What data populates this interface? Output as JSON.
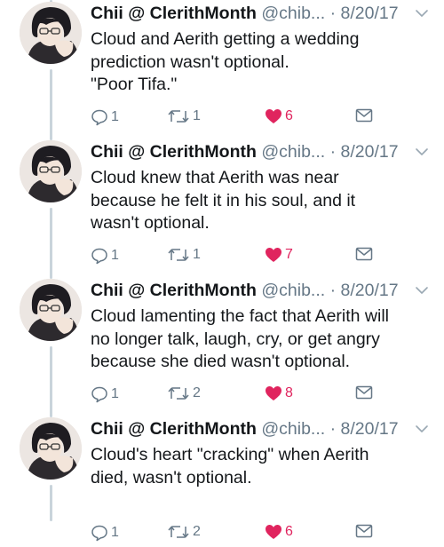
{
  "tweets": [
    {
      "name": "Chii @ ClerithMonth",
      "handle": "@chib...",
      "date": "· 8/20/17",
      "lines": [
        "Cloud and Aerith getting a wedding",
        "prediction wasn't optional.",
        "\"Poor Tifa.\""
      ],
      "replies": "1",
      "retweets": "1",
      "likes": "6"
    },
    {
      "name": "Chii @ ClerithMonth",
      "handle": "@chib...",
      "date": "· 8/20/17",
      "lines": [
        "Cloud knew that Aerith was near",
        "because he felt it in his soul, and it",
        "wasn't optional."
      ],
      "replies": "1",
      "retweets": "1",
      "likes": "7"
    },
    {
      "name": "Chii @ ClerithMonth",
      "handle": "@chib...",
      "date": "· 8/20/17",
      "lines": [
        "Cloud lamenting the fact that Aerith will",
        "no longer talk, laugh, cry, or get angry",
        "because she died wasn't optional."
      ],
      "replies": "1",
      "retweets": "2",
      "likes": "8"
    },
    {
      "name": "Chii @ ClerithMonth",
      "handle": "@chib...",
      "date": "· 8/20/17",
      "lines": [
        "Cloud's heart \"cracking\" when Aerith",
        "died, wasn't optional."
      ],
      "replies": "1",
      "retweets": "2",
      "likes": "6"
    }
  ],
  "icons": {
    "reply": "reply-icon",
    "retweet": "retweet-icon",
    "like": "heart-icon",
    "message": "envelope-icon",
    "more": "chevron-down-icon"
  },
  "colors": {
    "like": "#e0245e",
    "muted": "#657786",
    "text": "#14171a",
    "thread": "#c9d4db"
  }
}
